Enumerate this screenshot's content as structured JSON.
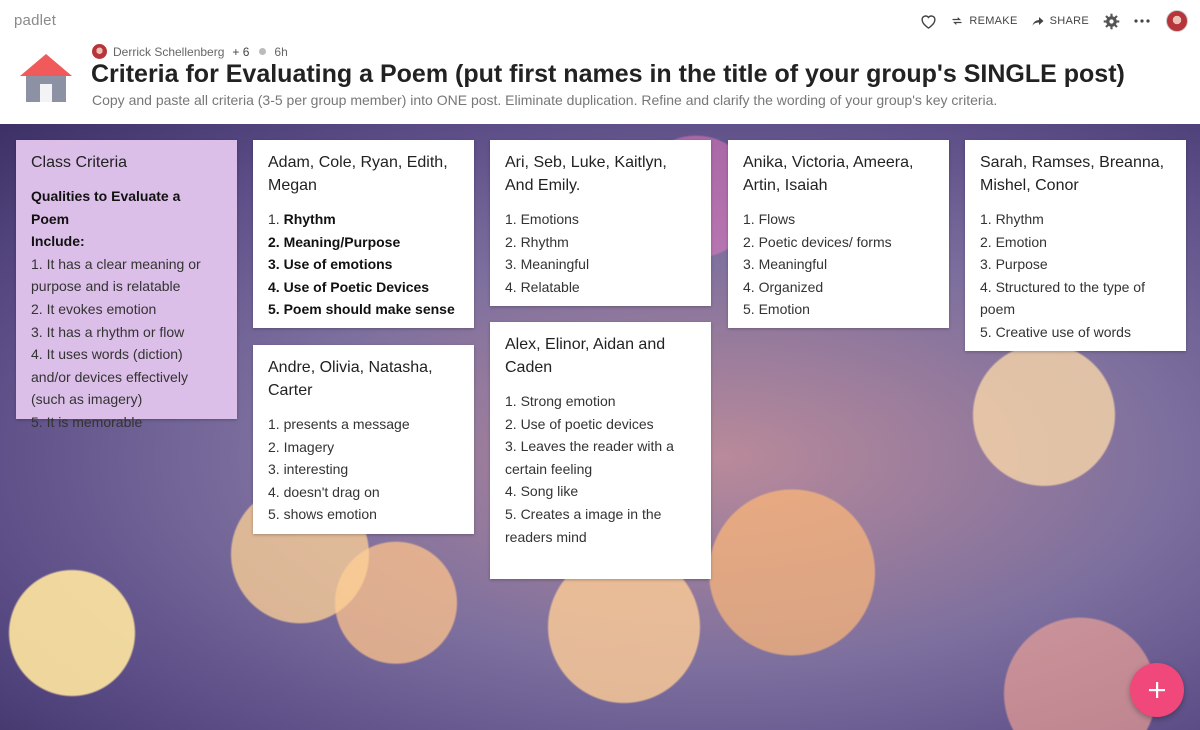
{
  "brand": "padlet",
  "toolbar": {
    "remake_label": "REMAKE",
    "share_label": "SHARE"
  },
  "board": {
    "author": "Derrick Schellenberg",
    "collaborators": "+ 6",
    "time_ago": "6h",
    "title": "Criteria for Evaluating a Poem (put first names in the title of your group's SINGLE post)",
    "description": "Copy and paste all criteria (3-5 per group member) into ONE post. Eliminate duplication. Refine and clarify the wording of your group's key criteria."
  },
  "posts": {
    "class_criteria": {
      "title": "Class Criteria",
      "lines": [
        {
          "text": "Qualities to Evaluate a Poem",
          "bold": true
        },
        {
          "text": "Include:",
          "bold": true
        },
        {
          "text": "1. It has a clear meaning or",
          "bold": false
        },
        {
          "text": "purpose and is relatable",
          "bold": false
        },
        {
          "text": "2. It evokes emotion",
          "bold": false
        },
        {
          "text": "3. It has a rhythm or flow",
          "bold": false
        },
        {
          "text": "4. It uses words (diction)",
          "bold": false
        },
        {
          "text": "and/or devices effectively",
          "bold": false
        },
        {
          "text": "(such as imagery)",
          "bold": false
        },
        {
          "text": "5. It is memorable",
          "bold": false
        }
      ]
    },
    "adam_group": {
      "title": "Adam, Cole, Ryan, Edith, Megan",
      "lines": [
        {
          "text": "1. ",
          "bold_text": "Rhythm"
        },
        {
          "text": "",
          "bold_text": "2. Meaning/Purpose"
        },
        {
          "text": "",
          "bold_text": "3. Use of emotions"
        },
        {
          "text": "",
          "bold_text": "4. Use of Poetic Devices"
        },
        {
          "text": "",
          "bold_text": "5. Poem should make sense"
        }
      ]
    },
    "andre_group": {
      "title": "Andre, Olivia, Natasha, Carter",
      "lines": [
        "1. presents a message",
        "2. Imagery",
        "3. interesting",
        "4. doesn't drag on",
        "5. shows emotion"
      ]
    },
    "ari_group": {
      "title": "Ari, Seb, Luke, Kaitlyn, And Emily.",
      "lines": [
        "1. Emotions",
        "2. Rhythm",
        "3. Meaningful",
        "4. Relatable"
      ]
    },
    "alex_group": {
      "title": "Alex, Elinor, Aidan and Caden",
      "lines": [
        "1. Strong emotion",
        "2. Use of poetic devices",
        "3. Leaves the reader with a",
        "certain feeling",
        "4. Song like",
        "5. Creates a image in the",
        "readers mind"
      ]
    },
    "anika_group": {
      "title": "Anika, Victoria, Ameera, Artin, Isaiah",
      "lines": [
        "1. Flows",
        "2. Poetic devices/ forms",
        "3. Meaningful",
        "4. Organized",
        "5. Emotion"
      ]
    },
    "sarah_group": {
      "title": "Sarah, Ramses, Breanna, Mishel, Conor",
      "lines": [
        "1. Rhythm",
        "2. Emotion",
        "3. Purpose",
        "4. Structured to the type of",
        "poem",
        "5. Creative use of words"
      ]
    }
  },
  "icons": {
    "like": "heart-icon",
    "remake": "repeat-icon",
    "share": "share-arrow-icon",
    "settings": "gear-icon",
    "more": "ellipsis-icon",
    "home": "house-icon",
    "add": "plus-icon"
  },
  "colors": {
    "accent": "#f0487a",
    "class_card": "#dcbfe8",
    "home_roof": "#f05a5a",
    "home_body": "#8c92a4"
  }
}
